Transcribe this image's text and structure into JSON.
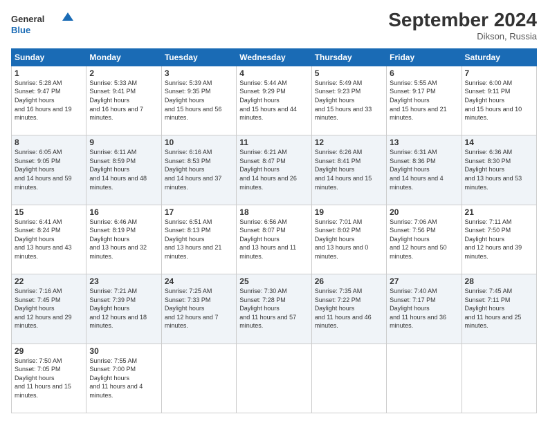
{
  "header": {
    "logo_general": "General",
    "logo_blue": "Blue",
    "month_title": "September 2024",
    "location": "Dikson, Russia"
  },
  "days_of_week": [
    "Sunday",
    "Monday",
    "Tuesday",
    "Wednesday",
    "Thursday",
    "Friday",
    "Saturday"
  ],
  "weeks": [
    [
      {
        "day": "1",
        "sunrise": "5:28 AM",
        "sunset": "9:47 PM",
        "daylight": "16 hours and 19 minutes."
      },
      {
        "day": "2",
        "sunrise": "5:33 AM",
        "sunset": "9:41 PM",
        "daylight": "16 hours and 7 minutes."
      },
      {
        "day": "3",
        "sunrise": "5:39 AM",
        "sunset": "9:35 PM",
        "daylight": "15 hours and 56 minutes."
      },
      {
        "day": "4",
        "sunrise": "5:44 AM",
        "sunset": "9:29 PM",
        "daylight": "15 hours and 44 minutes."
      },
      {
        "day": "5",
        "sunrise": "5:49 AM",
        "sunset": "9:23 PM",
        "daylight": "15 hours and 33 minutes."
      },
      {
        "day": "6",
        "sunrise": "5:55 AM",
        "sunset": "9:17 PM",
        "daylight": "15 hours and 21 minutes."
      },
      {
        "day": "7",
        "sunrise": "6:00 AM",
        "sunset": "9:11 PM",
        "daylight": "15 hours and 10 minutes."
      }
    ],
    [
      {
        "day": "8",
        "sunrise": "6:05 AM",
        "sunset": "9:05 PM",
        "daylight": "14 hours and 59 minutes."
      },
      {
        "day": "9",
        "sunrise": "6:11 AM",
        "sunset": "8:59 PM",
        "daylight": "14 hours and 48 minutes."
      },
      {
        "day": "10",
        "sunrise": "6:16 AM",
        "sunset": "8:53 PM",
        "daylight": "14 hours and 37 minutes."
      },
      {
        "day": "11",
        "sunrise": "6:21 AM",
        "sunset": "8:47 PM",
        "daylight": "14 hours and 26 minutes."
      },
      {
        "day": "12",
        "sunrise": "6:26 AM",
        "sunset": "8:41 PM",
        "daylight": "14 hours and 15 minutes."
      },
      {
        "day": "13",
        "sunrise": "6:31 AM",
        "sunset": "8:36 PM",
        "daylight": "14 hours and 4 minutes."
      },
      {
        "day": "14",
        "sunrise": "6:36 AM",
        "sunset": "8:30 PM",
        "daylight": "13 hours and 53 minutes."
      }
    ],
    [
      {
        "day": "15",
        "sunrise": "6:41 AM",
        "sunset": "8:24 PM",
        "daylight": "13 hours and 43 minutes."
      },
      {
        "day": "16",
        "sunrise": "6:46 AM",
        "sunset": "8:19 PM",
        "daylight": "13 hours and 32 minutes."
      },
      {
        "day": "17",
        "sunrise": "6:51 AM",
        "sunset": "8:13 PM",
        "daylight": "13 hours and 21 minutes."
      },
      {
        "day": "18",
        "sunrise": "6:56 AM",
        "sunset": "8:07 PM",
        "daylight": "13 hours and 11 minutes."
      },
      {
        "day": "19",
        "sunrise": "7:01 AM",
        "sunset": "8:02 PM",
        "daylight": "13 hours and 0 minutes."
      },
      {
        "day": "20",
        "sunrise": "7:06 AM",
        "sunset": "7:56 PM",
        "daylight": "12 hours and 50 minutes."
      },
      {
        "day": "21",
        "sunrise": "7:11 AM",
        "sunset": "7:50 PM",
        "daylight": "12 hours and 39 minutes."
      }
    ],
    [
      {
        "day": "22",
        "sunrise": "7:16 AM",
        "sunset": "7:45 PM",
        "daylight": "12 hours and 29 minutes."
      },
      {
        "day": "23",
        "sunrise": "7:21 AM",
        "sunset": "7:39 PM",
        "daylight": "12 hours and 18 minutes."
      },
      {
        "day": "24",
        "sunrise": "7:25 AM",
        "sunset": "7:33 PM",
        "daylight": "12 hours and 7 minutes."
      },
      {
        "day": "25",
        "sunrise": "7:30 AM",
        "sunset": "7:28 PM",
        "daylight": "11 hours and 57 minutes."
      },
      {
        "day": "26",
        "sunrise": "7:35 AM",
        "sunset": "7:22 PM",
        "daylight": "11 hours and 46 minutes."
      },
      {
        "day": "27",
        "sunrise": "7:40 AM",
        "sunset": "7:17 PM",
        "daylight": "11 hours and 36 minutes."
      },
      {
        "day": "28",
        "sunrise": "7:45 AM",
        "sunset": "7:11 PM",
        "daylight": "11 hours and 25 minutes."
      }
    ],
    [
      {
        "day": "29",
        "sunrise": "7:50 AM",
        "sunset": "7:05 PM",
        "daylight": "11 hours and 15 minutes."
      },
      {
        "day": "30",
        "sunrise": "7:55 AM",
        "sunset": "7:00 PM",
        "daylight": "11 hours and 4 minutes."
      },
      null,
      null,
      null,
      null,
      null
    ]
  ]
}
